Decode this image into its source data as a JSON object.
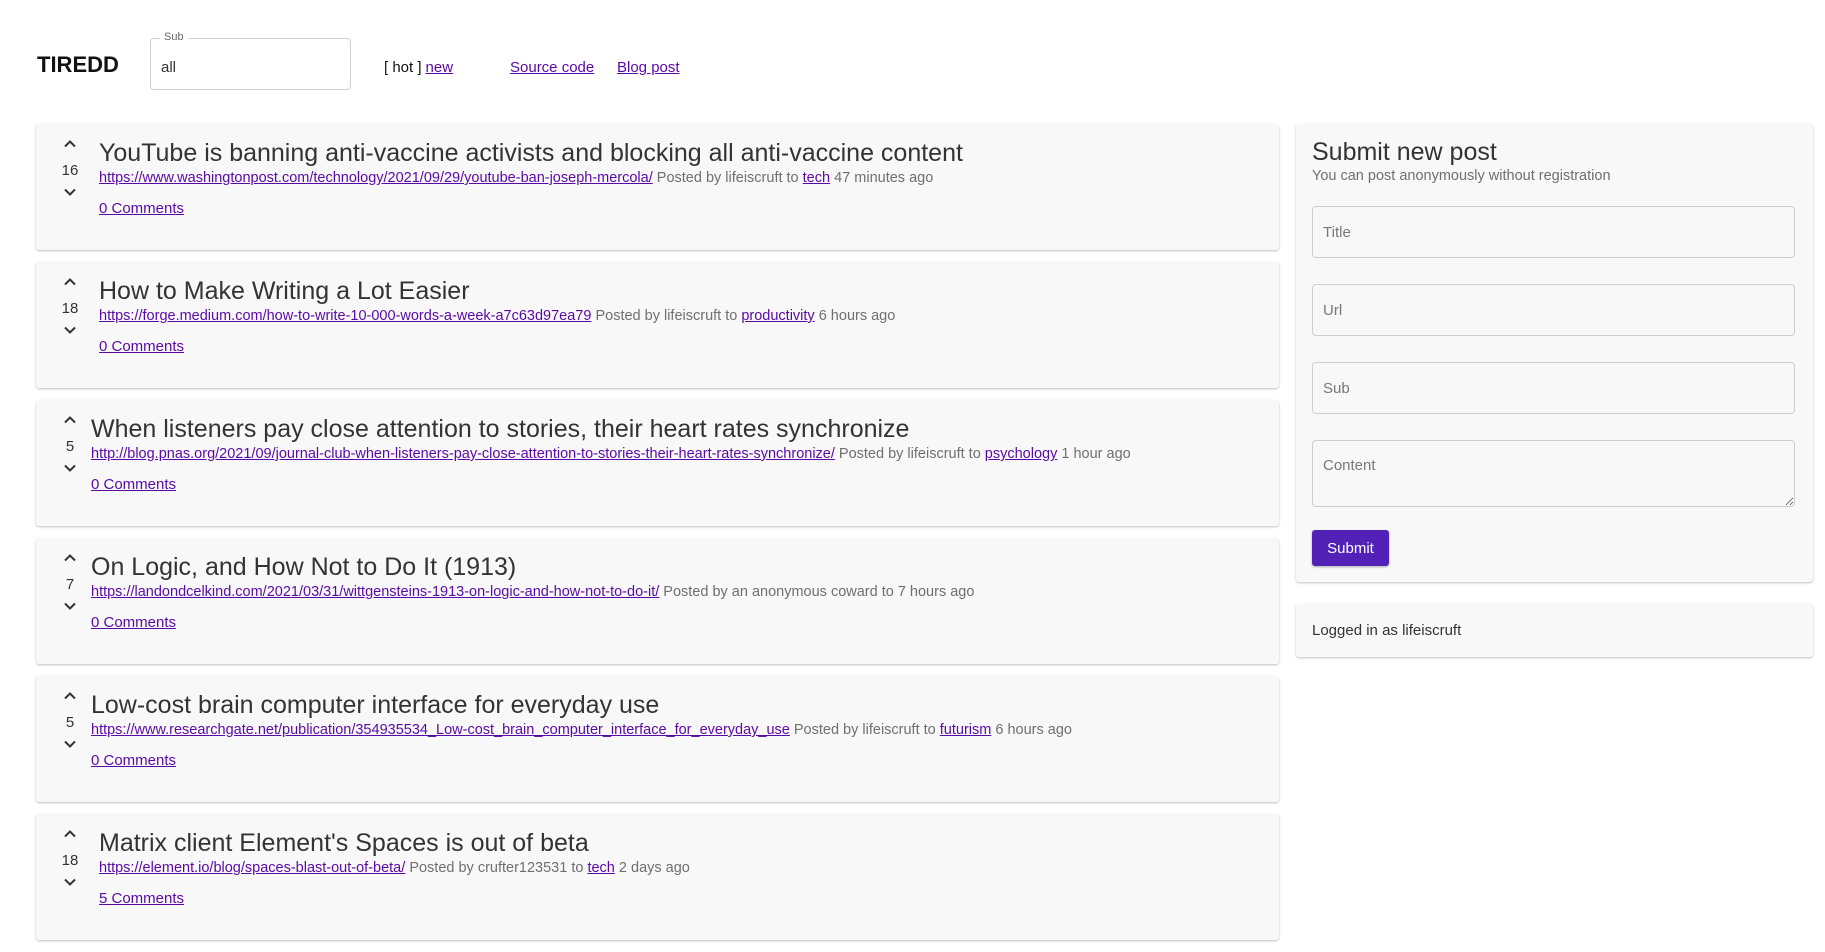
{
  "header": {
    "brand": "TIREDD",
    "sub_legend": "Sub",
    "sub_value": "all",
    "sort_hot": "[ hot ]",
    "sort_new": "new",
    "source_code": "Source code",
    "blog_post": "Blog post"
  },
  "posts": [
    {
      "score": "16",
      "title": "YouTube is banning anti-vaccine activists and blocking all anti-vaccine content",
      "url": "https://www.washingtonpost.com/technology/2021/09/29/youtube-ban-joseph-mercola/",
      "posted_by": "Posted by lifeiscruft to",
      "sub": "tech",
      "time": "47 minutes ago",
      "comments": "0 Comments"
    },
    {
      "score": "18",
      "title": "How to Make Writing a Lot Easier",
      "url": "https://forge.medium.com/how-to-write-10-000-words-a-week-a7c63d97ea79",
      "posted_by": "Posted by lifeiscruft to",
      "sub": "productivity",
      "time": "6 hours ago",
      "comments": "0 Comments"
    },
    {
      "score": "5",
      "title": "When listeners pay close attention to stories, their heart rates synchronize",
      "url": "http://blog.pnas.org/2021/09/journal-club-when-listeners-pay-close-attention-to-stories-their-heart-rates-synchronize/",
      "posted_by": "Posted by lifeiscruft to",
      "sub": "psychology",
      "time": "1 hour ago",
      "comments": "0 Comments"
    },
    {
      "score": "7",
      "title": "On Logic, and How Not to Do It (1913)",
      "url": "https://landondcelkind.com/2021/03/31/wittgensteins-1913-on-logic-and-how-not-to-do-it/",
      "posted_by": "Posted by an anonymous coward to 7 hours ago",
      "comments": "0 Comments"
    },
    {
      "score": "5",
      "title": "Low-cost brain computer interface for everyday use",
      "url": "https://www.researchgate.net/publication/354935534_Low-cost_brain_computer_interface_for_everyday_use",
      "posted_by": "Posted by lifeiscruft to",
      "sub": "futurism",
      "time": "6 hours ago",
      "comments": "0 Comments"
    },
    {
      "score": "18",
      "title": "Matrix client Element's Spaces is out of beta",
      "url": "https://element.io/blog/spaces-blast-out-of-beta/",
      "posted_by": "Posted by crufter123531 to",
      "sub": "tech",
      "time": "2 days ago",
      "comments": "5 Comments"
    }
  ],
  "submit": {
    "title": "Submit new post",
    "subtitle": "You can post anonymously without registration",
    "title_placeholder": "Title",
    "url_placeholder": "Url",
    "sub_placeholder": "Sub",
    "content_placeholder": "Content",
    "button": "Submit"
  },
  "login": {
    "text": "Logged in as lifeiscruft"
  },
  "colors": {
    "link": "#5a0aa4",
    "button": "#5222b8",
    "card_bg": "#f8f8f8"
  },
  "icons": {
    "upvote": "chevron-up-icon",
    "downvote": "chevron-down-icon"
  }
}
